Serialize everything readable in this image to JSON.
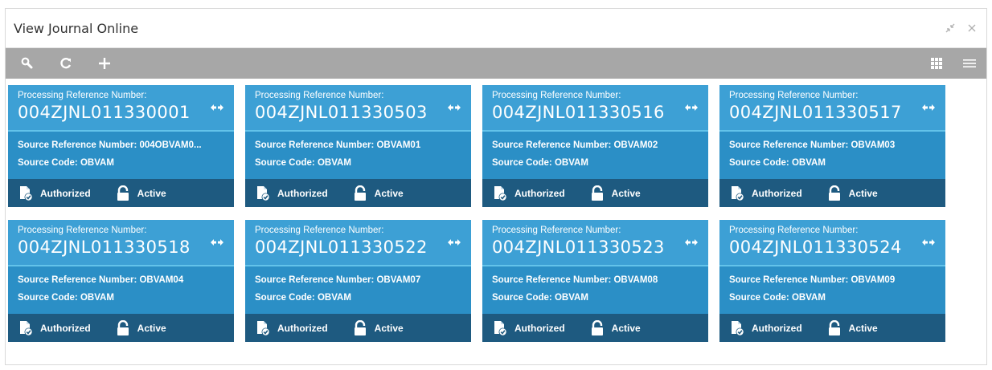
{
  "window": {
    "title": "View Journal Online"
  },
  "toolbar": {
    "left_icons": [
      "search-icon",
      "refresh-icon",
      "add-icon"
    ],
    "right_icons": [
      "grid-view-icon",
      "list-view-icon"
    ]
  },
  "colors": {
    "toolbar_bg": "#a7a7a7",
    "card_header": "#3da0d5",
    "card_body": "#2b8fc6",
    "card_footer": "#1e5a80"
  },
  "cards": [
    {
      "label": "Processing Reference Number:",
      "ref": "004ZJNL011330001",
      "source_ref_label": "Source Reference Number:",
      "source_ref": "004OBVAM0...",
      "source_code_label": "Source Code:",
      "source_code": "OBVAM",
      "auth_status": "Authorized",
      "record_status": "Active"
    },
    {
      "label": "Processing Reference Number:",
      "ref": "004ZJNL011330503",
      "source_ref_label": "Source Reference Number:",
      "source_ref": "OBVAM01",
      "source_code_label": "Source Code:",
      "source_code": "OBVAM",
      "auth_status": "Authorized",
      "record_status": "Active"
    },
    {
      "label": "Processing Reference Number:",
      "ref": "004ZJNL011330516",
      "source_ref_label": "Source Reference Number:",
      "source_ref": "OBVAM02",
      "source_code_label": "Source Code:",
      "source_code": "OBVAM",
      "auth_status": "Authorized",
      "record_status": "Active"
    },
    {
      "label": "Processing Reference Number:",
      "ref": "004ZJNL011330517",
      "source_ref_label": "Source Reference Number:",
      "source_ref": "OBVAM03",
      "source_code_label": "Source Code:",
      "source_code": "OBVAM",
      "auth_status": "Authorized",
      "record_status": "Active"
    },
    {
      "label": "Processing Reference Number:",
      "ref": "004ZJNL011330518",
      "source_ref_label": "Source Reference Number:",
      "source_ref": "OBVAM04",
      "source_code_label": "Source Code:",
      "source_code": "OBVAM",
      "auth_status": "Authorized",
      "record_status": "Active"
    },
    {
      "label": "Processing Reference Number:",
      "ref": "004ZJNL011330522",
      "source_ref_label": "Source Reference Number:",
      "source_ref": "OBVAM07",
      "source_code_label": "Source Code:",
      "source_code": "OBVAM",
      "auth_status": "Authorized",
      "record_status": "Active"
    },
    {
      "label": "Processing Reference Number:",
      "ref": "004ZJNL011330523",
      "source_ref_label": "Source Reference Number:",
      "source_ref": "OBVAM08",
      "source_code_label": "Source Code:",
      "source_code": "OBVAM",
      "auth_status": "Authorized",
      "record_status": "Active"
    },
    {
      "label": "Processing Reference Number:",
      "ref": "004ZJNL011330524",
      "source_ref_label": "Source Reference Number:",
      "source_ref": "OBVAM09",
      "source_code_label": "Source Code:",
      "source_code": "OBVAM",
      "auth_status": "Authorized",
      "record_status": "Active"
    }
  ]
}
